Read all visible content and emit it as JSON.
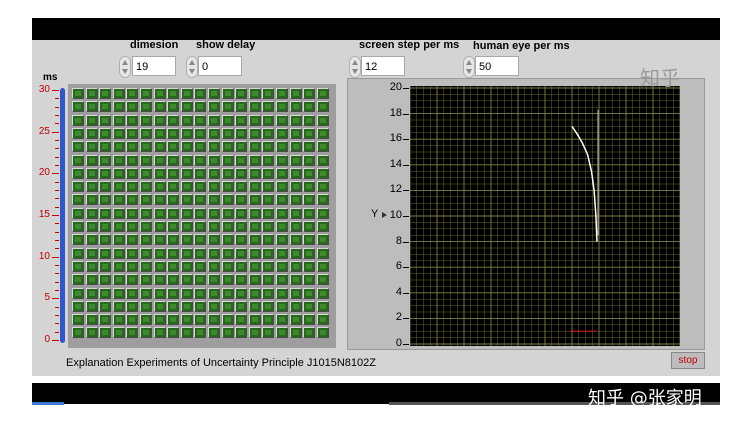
{
  "controls": {
    "dimension": {
      "label": "dimesion",
      "value": "19"
    },
    "show_delay": {
      "label": "show delay",
      "value": "0"
    },
    "screen_step": {
      "label": "screen step per ms",
      "value": "12"
    },
    "human_eye": {
      "label": "human eye per ms",
      "value": "50"
    }
  },
  "slider": {
    "units": "ms",
    "ticks": [
      "30",
      "25",
      "20",
      "15",
      "10",
      "5",
      "0"
    ],
    "value": 30,
    "range": [
      0,
      30
    ]
  },
  "led_grid": {
    "rows": 19,
    "cols": 19,
    "state": "green"
  },
  "graph": {
    "ylabel": "Y",
    "yticks": [
      "20",
      "18",
      "16",
      "14",
      "12",
      "10",
      "8",
      "6",
      "4",
      "2",
      "0"
    ],
    "ylim": [
      0,
      20
    ],
    "curve": [
      [
        0.0,
        17.0
      ],
      [
        0.2,
        16.4
      ],
      [
        0.4,
        15.7
      ],
      [
        0.6,
        14.8
      ],
      [
        0.75,
        13.5
      ],
      [
        0.85,
        12.0
      ],
      [
        0.92,
        10.0
      ],
      [
        0.96,
        8.0
      ]
    ],
    "curve_x_pixels_note": "",
    "red_marker_y": 1.0
  },
  "caption": "Explanation Experiments of Uncertainty Principle  J1015N8102Z",
  "stop_label": "stop",
  "watermarks": {
    "top": "知乎",
    "bottom": "知乎 @张家明"
  },
  "colors": {
    "led": "#26681c",
    "slider": "#3355cc",
    "ticks": "#c00000",
    "grid": "#808040",
    "curve": "#ffffff"
  }
}
